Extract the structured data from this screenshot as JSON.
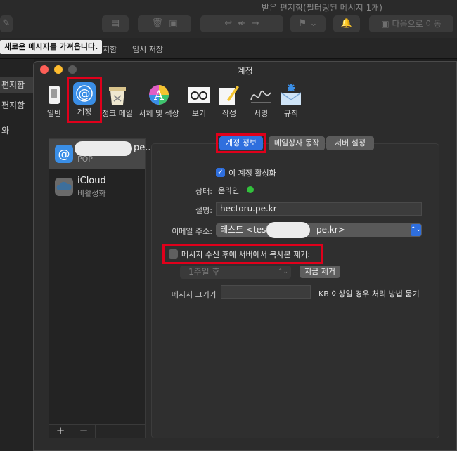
{
  "background": {
    "window_title": "받은 편지함(필터링된 메시지 1개)",
    "next_button": "다음으로 이동",
    "tooltip": "새로운 메시지를 가져옵니다.",
    "tabs": [
      "지함",
      "임시 저장"
    ],
    "sidebar": [
      "편지함",
      "편지함",
      "와"
    ]
  },
  "prefs": {
    "title": "계정",
    "toolbar": [
      {
        "label": "일반",
        "icon": "switch-icon"
      },
      {
        "label": "계정",
        "icon": "at-sign-icon"
      },
      {
        "label": "정크 메일",
        "icon": "trash-bin-icon"
      },
      {
        "label": "서체 및 색상",
        "icon": "font-color-icon"
      },
      {
        "label": "보기",
        "icon": "glasses-icon"
      },
      {
        "label": "작성",
        "icon": "pencil-icon"
      },
      {
        "label": "서명",
        "icon": "signature-icon"
      },
      {
        "label": "규칙",
        "icon": "rules-envelope-icon"
      }
    ],
    "accounts": [
      {
        "name_suffix": "pe....",
        "type": "POP"
      },
      {
        "name": "iCloud",
        "status": "비활성화"
      }
    ],
    "list_buttons": {
      "add": "+",
      "remove": "−"
    },
    "tabs": [
      "계정 정보",
      "메일상자 동작",
      "서버 설정"
    ],
    "form": {
      "enable_label": "이 계정 활성화",
      "status_label": "상태:",
      "status_value": "온라인",
      "desc_label": "설명:",
      "desc_value": "hectoru.pe.kr",
      "email_label": "이메일 주소:",
      "email_prefix": "테스트 <test",
      "email_suffix": "pe.kr>",
      "remove_copy_label": "메시지 수신 후에 서버에서 복사본 제거:",
      "remove_after_value": "1주일 후",
      "remove_now_button": "지금 제거",
      "size_label": "메시지 크기가",
      "size_suffix": "KB 이상일 경우 처리 방법 묻기"
    }
  },
  "colors": {
    "accent": "#2f6fde",
    "highlight": "#e0001b",
    "online": "#32c13c"
  }
}
